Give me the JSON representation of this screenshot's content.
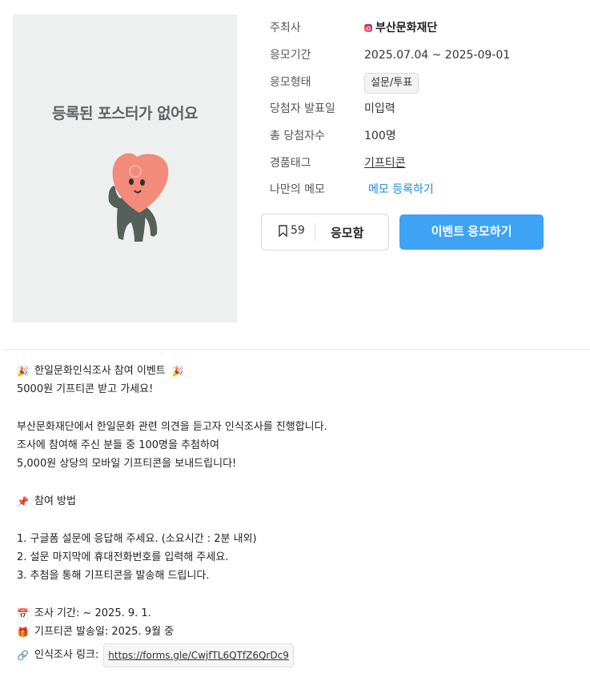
{
  "poster": {
    "empty_text": "등록된 포스터가 없어요"
  },
  "info": {
    "host_label": "주최사",
    "host_value": "부산문화재단",
    "period_label": "응모기간",
    "period_value": "2025.07.04 ~ 2025-09-01",
    "type_label": "응모형태",
    "type_value": "설문/투표",
    "announce_label": "당첨자 발표일",
    "announce_value": "미입력",
    "winners_label": "총 당첨자수",
    "winners_value": "100명",
    "prize_label": "경품태그",
    "prize_value": "기프티콘",
    "memo_label": "나만의 메모",
    "memo_link": "메모 등록하기"
  },
  "actions": {
    "bookmark_count": "59",
    "applied_label": "응모함",
    "apply_button": "이벤트 응모하기"
  },
  "description": {
    "l1": "한일문화인식조사 참여 이벤트",
    "l2": "5000원 기프티콘 받고 가세요!",
    "l3": "부산문화재단에서 한일문화 관련 의견을 듣고자 인식조사를 진행합니다.",
    "l4": "조사에 참여해 주신 분들 중 100명을 추첨하여",
    "l5": "5,000원 상당의 모바일 기프티콘을 보내드립니다!",
    "l6": "참여 방법",
    "l7": "1. 구글폼 설문에 응답해 주세요. (소요시간 : 2분 내외)",
    "l8": "2. 설문 마지막에 휴대전화번호를 입력해 주세요.",
    "l9": "3. 추첨을 통해 기프티콘을 발송해 드립니다.",
    "l10": "조사 기간: ~ 2025. 9. 1.",
    "l11": "기프티콘 발송일: 2025. 9월 중",
    "l12": "인식조사 링크:",
    "link": "https://forms.gle/CwjfTL6QTfZ6QrDc9"
  },
  "icons": {
    "party": "party-popper-icon",
    "pin": "pushpin-icon",
    "calendar": "calendar-icon",
    "gift": "gift-icon",
    "link": "link-icon",
    "bookmark": "bookmark-icon"
  },
  "colors": {
    "primary": "#3ea3f4",
    "link": "#1b8ad6"
  }
}
